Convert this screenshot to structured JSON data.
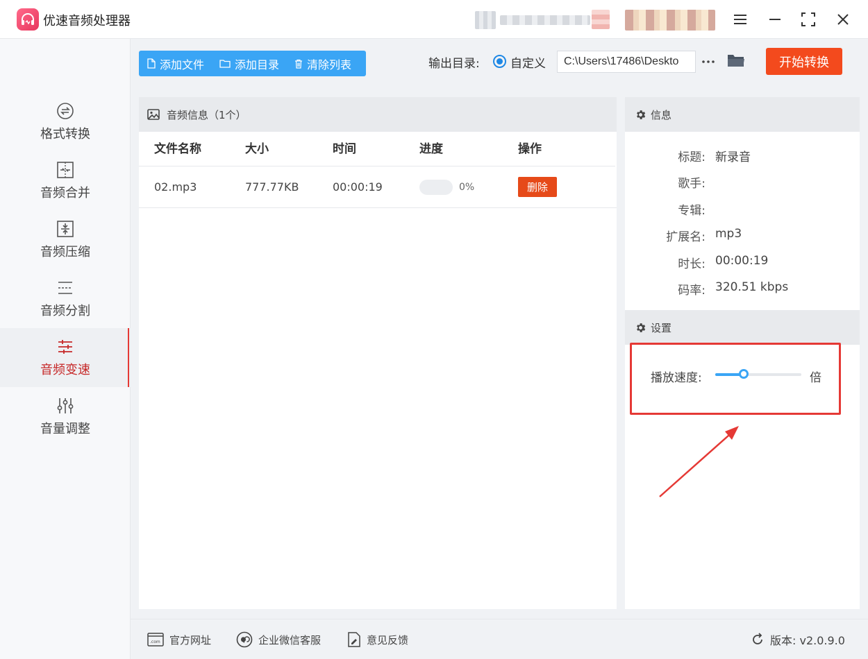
{
  "app": {
    "title": "优速音频处理器",
    "accent_color": "#f34a1d",
    "primary_color": "#3aa5f5"
  },
  "window_controls": [
    "menu-icon",
    "minimize-icon",
    "maximize-icon",
    "close-icon"
  ],
  "sidebar": {
    "items": [
      {
        "label": "格式转换",
        "icon": "format-convert-icon",
        "active": false
      },
      {
        "label": "音频合并",
        "icon": "merge-icon",
        "active": false
      },
      {
        "label": "音频压缩",
        "icon": "compress-icon",
        "active": false
      },
      {
        "label": "音频分割",
        "icon": "split-icon",
        "active": false
      },
      {
        "label": "音频变速",
        "icon": "speed-icon",
        "active": true
      },
      {
        "label": "音量调整",
        "icon": "volume-adjust-icon",
        "active": false
      }
    ]
  },
  "toolbar": {
    "add_file": "添加文件",
    "add_folder": "添加目录",
    "clear_list": "清除列表",
    "output_label": "输出目录:",
    "output_option": "自定义",
    "output_path": "C:\\Users\\17486\\Deskto",
    "more": "···",
    "start": "开始转换"
  },
  "file_list": {
    "header": "音频信息（1个）",
    "columns": [
      "文件名称",
      "大小",
      "时间",
      "进度",
      "操作"
    ],
    "rows": [
      {
        "name": "02.mp3",
        "size": "777.77KB",
        "duration": "00:00:19",
        "progress": 0,
        "progress_text": "0%",
        "action": "删除"
      }
    ]
  },
  "info": {
    "header": "信息",
    "rows": [
      {
        "key": "标题:",
        "value": "新录音"
      },
      {
        "key": "歌手:",
        "value": ""
      },
      {
        "key": "专辑:",
        "value": ""
      },
      {
        "key": "扩展名:",
        "value": "mp3"
      },
      {
        "key": "时长:",
        "value": "00:00:19"
      },
      {
        "key": "码率:",
        "value": "320.51 kbps"
      }
    ]
  },
  "settings": {
    "header": "设置",
    "speed_label": "播放速度:",
    "speed_unit": "倍",
    "speed_slider_fraction": 0.33,
    "highlight_color": "#e53935"
  },
  "footer": {
    "website": "官方网址",
    "wechat": "企业微信客服",
    "feedback": "意见反馈",
    "version": "版本:  v2.0.9.0"
  }
}
